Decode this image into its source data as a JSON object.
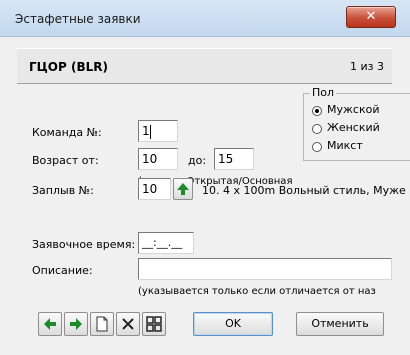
{
  "window": {
    "title": "Эстафетные заявки",
    "close_glyph": "✕"
  },
  "header": {
    "title": "ГЦОР (BLR)",
    "counter": "1 из 3"
  },
  "form": {
    "team_label": "Команда №:",
    "team_value": "1",
    "age_from_label": "Возраст от:",
    "age_from_value": "10",
    "age_to_label": "до:",
    "age_to_value": "15",
    "age_hint": "(пусто = Открытая/Основная",
    "swim_label": "Заплыв №:",
    "swim_value": "10",
    "swim_desc": "10. 4 x 100m Вольный стиль, Муже",
    "entry_time_label": "Заявочное время:",
    "entry_time_value": "__:__.__",
    "description_label": "Описание:",
    "description_value": "",
    "description_hint": "(указывается только если отличается от наз"
  },
  "gender": {
    "legend": "Пол",
    "options": [
      "Мужской",
      "Женский",
      "Микст"
    ],
    "selected": "Мужской"
  },
  "toolbar": {
    "prev_icon": "←",
    "next_icon": "→",
    "new_icon": "🗋",
    "delete_icon": "✕",
    "ok_label": "OK",
    "cancel_label": "Отменить"
  },
  "colors": {
    "arrow": "#1e8a2a",
    "close": "#c8503b"
  }
}
